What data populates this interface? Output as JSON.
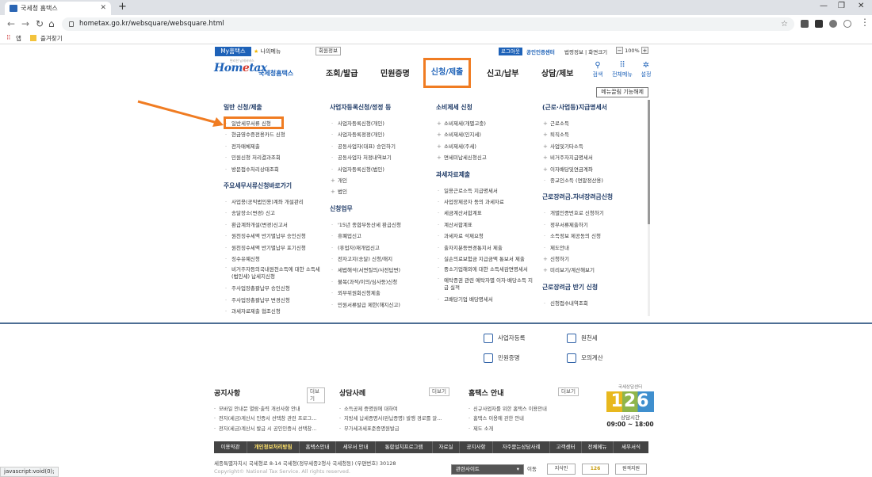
{
  "browser": {
    "tab_title": "국세청 홈택스",
    "url": "hometax.go.kr/websquare/websquare.html",
    "bookmarks": [
      "앱",
      "즐겨찾기"
    ],
    "status_url": "javascript:void(0);"
  },
  "topbar": {
    "my_hometax": "My홈택스",
    "my_menu": "나의메뉴",
    "member_info": "회원정보",
    "logout": "로그아웃",
    "cert_center": "공인인증센터",
    "links": "법령정보 | 화면크기",
    "zoom_level": "100%",
    "zoom_minus": "−",
    "zoom_plus": "+"
  },
  "logo": {
    "brand_kr": "국세청홈택스",
    "brand_en_left": "Hom",
    "brand_en_accent": "e",
    "brand_en_right": "tax",
    "tagline": "편리한 납세서비스"
  },
  "gnb": {
    "items": [
      "조회/발급",
      "민원증명",
      "신청/제출",
      "신고/납부",
      "상담/제보"
    ],
    "search": "검색",
    "all_menu": "전체메뉴",
    "settings": "설정"
  },
  "megamenu": {
    "clip_button": "메뉴끌림 기능해제",
    "col1": {
      "h1": "일반 신청/제출",
      "items1": [
        "일반세무서류 신청",
        "현금영수증전용카드 신청",
        "전자매체제출",
        "민원신청 처리결과조회",
        "방문접수처리상태조회"
      ],
      "h2": "주요세무서류신청바로가기",
      "items2": [
        "사업용(공익법인용)계좌 개설관리",
        "송달장소(변경) 신고",
        "환급계좌개설(변경)신고서",
        "원천징수세액 반기별납부 승인신청",
        "원천징수세액 반기별납부 포기신청",
        "징수유예신청",
        "비거주자등의국내원천소득에 대한 소득세(법인세) 납세지신청",
        "주사업장총괄납부 승인신청",
        "주사업장총괄납부 변경신청",
        "과세자료제출 협조신청"
      ]
    },
    "col2": {
      "h1": "사업자등록신청/정정 등",
      "items1": [
        "사업자등록신청(개인)",
        "사업자등록정정(개인)",
        "공동사업자(대표) 승인하기",
        "공동사업자 처정내역보기",
        "사업자등록신청(법인)"
      ],
      "plus1": [
        "개인",
        "법인"
      ],
      "h2": "신청업무",
      "items2": [
        "'15년 종합부동산세 환급신청",
        "휴폐업신고",
        "(휴업자)재개업신고",
        "전자고지(송달) 신청/해지",
        "세법해석(서면질의/사전답변)",
        "불복(과적/이의/심사등)신청",
        "외부위원회신청제출",
        "민원서류발급 제한(해지신고)"
      ]
    },
    "col3": {
      "h1": "소비제세 신청",
      "plus1": [
        "소비제세(개별고충)",
        "소비제세(인지세)",
        "소비제세(주세)",
        "면세미납세신청신고"
      ],
      "h2": "과세자료제출",
      "items2": [
        "일용근로소득 지급명세서",
        "사업장제공자 등의 과세자료",
        "세금계산서합계표",
        "계산서합계표",
        "과세자료 석제요청",
        "출자지분등변경통지서 제출",
        "실손의료보험금 지급금액 통보서 제출",
        "중소기업해외에 대한 소득세감면명세서",
        "예탁증권 관련 예탁자별 이자·배당소득 지급 실적",
        "고배당기업 배당명세서"
      ]
    },
    "col4": {
      "h1": "(근로·사업등)지급명세서",
      "plus1": [
        "근로소득",
        "퇴직소득",
        "사업및기타소득",
        "비거주자지급명세서",
        "이자배당및연금계좌"
      ],
      "items1": [
        "종교인소득 (연말정산용)"
      ],
      "h2": "근로장려금.자녀장려금신청",
      "items2": [
        "개별인증번호로 신청하기",
        "정부서류제출하기",
        "소득정보 제공동의 신청",
        "제도안내"
      ],
      "plus2": [
        "신청하기",
        "미리보기/계산해보기"
      ],
      "h3": "근로장려금 반기 신청",
      "items3": [
        "신청접수내역조회"
      ]
    }
  },
  "quick": {
    "items": [
      "사업자등록",
      "원천세",
      "민원증명",
      "모의계산"
    ]
  },
  "boards": {
    "notice": {
      "title": "공지사항",
      "more": "더보기",
      "items": [
        "모바일 안내문 열람·출력 개선사항 안내",
        "전자(세금)계산서 인증서 선택창 관련 프로그...",
        "전자(세금)계산서 발급 시 공인인증서 선택창..."
      ]
    },
    "cases": {
      "title": "상담사례",
      "more": "더보기",
      "items": [
        "소득공제 증명원에 대하여",
        "지방세 납세증명서(완납증명) 발행 경로를 알...",
        "부가세과세표준증명원발급"
      ]
    },
    "guide": {
      "title": "홈택스 안내",
      "more": "더보기",
      "items": [
        "신규사업자를 위한 홈택스 이용안내",
        "홈택스 이용에 관한 안내",
        "제도 소개"
      ]
    }
  },
  "center": {
    "label": "국세상담센터",
    "number": "126",
    "hours_label": "상담시간",
    "hours": "09:00 ~ 18:00"
  },
  "footer": {
    "links": [
      "이용약관",
      "개인정보처리방침",
      "홈택스안내",
      "세무서 안내",
      "통합설치프로그램",
      "자료실",
      "공지사항",
      "자주묻는상담사례",
      "고객센터",
      "전체메뉴",
      "세무서식"
    ],
    "address": "세종특별자치시 국세청로 8-14 국세청(정부세종2청사 국세청동) (우편번호) 30128",
    "copyright": "Copyright© National Tax Service. All rights reserved.",
    "related": "관련사이트",
    "go": "이동",
    "banners": [
      "지식인",
      "126",
      "원격지원"
    ]
  },
  "colors": {
    "accent": "#f07c22",
    "brand": "#1e62b8"
  }
}
